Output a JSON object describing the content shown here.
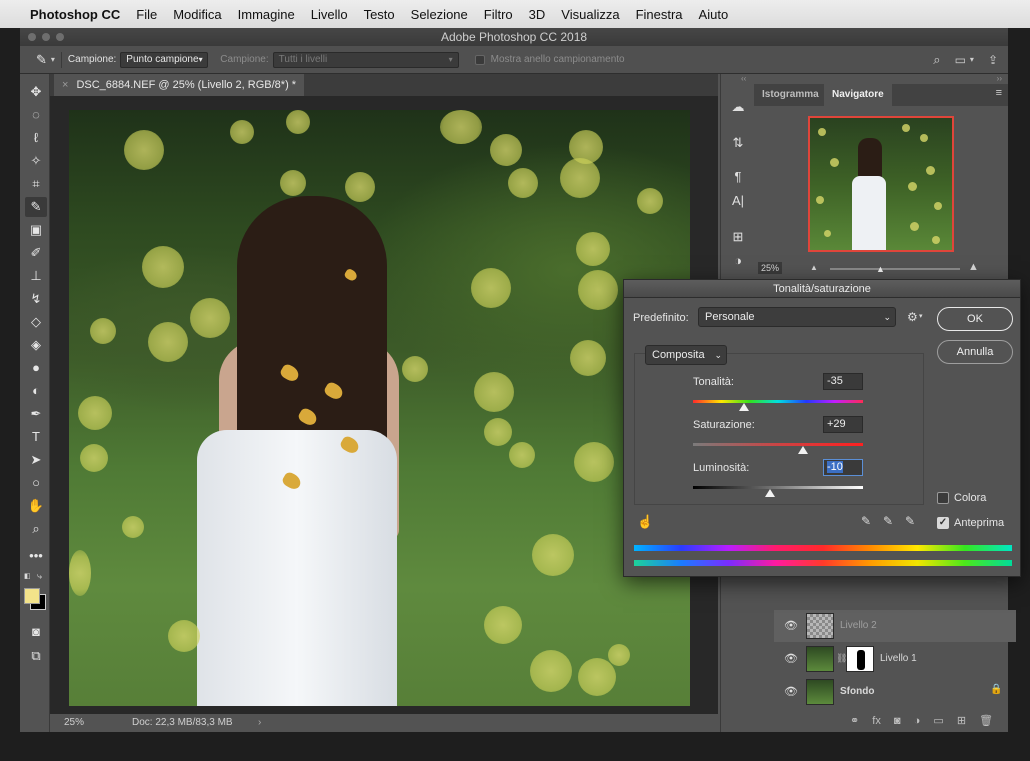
{
  "menubar": {
    "items": [
      "Photoshop CC",
      "File",
      "Modifica",
      "Immagine",
      "Livello",
      "Testo",
      "Selezione",
      "Filtro",
      "3D",
      "Visualizza",
      "Finestra",
      "Aiuto"
    ]
  },
  "window": {
    "title": "Adobe Photoshop CC 2018"
  },
  "options_bar": {
    "sample_label": "Campione:",
    "sample_value": "Punto campione",
    "sample2_label": "Campione:",
    "sample2_value": "Tutti i livelli",
    "ring_label": "Mostra anello campionamento"
  },
  "document": {
    "tab_title": "DSC_6884.NEF @ 25% (Livello 2, RGB/8*) *",
    "zoom": "25%",
    "doc_size": "Doc: 22,3 MB/83,3 MB"
  },
  "panels": {
    "tabs": [
      "Istogramma",
      "Navigatore"
    ],
    "nav_zoom": "25%"
  },
  "layers": [
    {
      "name": "Livello 2"
    },
    {
      "name": "Livello 1"
    },
    {
      "name": "Sfondo"
    }
  ],
  "dialog": {
    "title": "Tonalità/saturazione",
    "preset_label": "Predefinito:",
    "preset_value": "Personale",
    "ok": "OK",
    "cancel": "Annulla",
    "channel": "Composita",
    "hue_label": "Tonalità:",
    "hue_value": "-35",
    "hue_level": 0.3,
    "sat_label": "Saturazione:",
    "sat_value": "+29",
    "sat_level": 0.645,
    "light_label": "Luminosità:",
    "light_value": "-10",
    "light_level": 0.45,
    "colorize_label": "Colora",
    "colorize_checked": false,
    "preview_label": "Anteprima",
    "preview_checked": true
  },
  "colors": {
    "foreground": "#f3e38a",
    "background": "#000000",
    "accent": "#5b8fd6"
  }
}
